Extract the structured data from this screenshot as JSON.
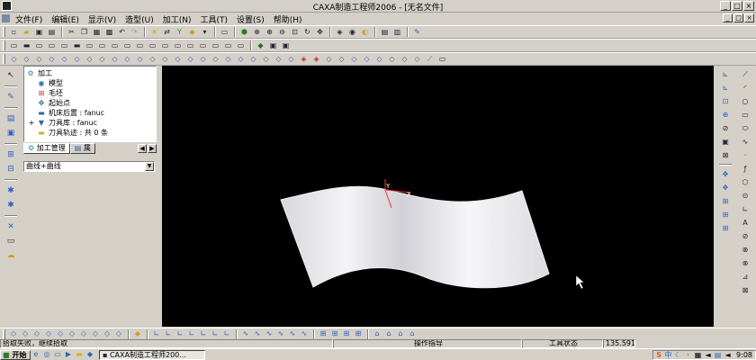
{
  "window": {
    "title": "CAXA制造工程师2006 - [无名文件]",
    "controls": [
      "_",
      "□",
      "×"
    ]
  },
  "menubar": {
    "items": [
      "文件(F)",
      "编辑(E)",
      "显示(V)",
      "造型(U)",
      "加工(N)",
      "工具(T)",
      "设置(S)",
      "帮助(H)"
    ],
    "mdi_controls": [
      "_",
      "□",
      "×"
    ]
  },
  "tree": {
    "root": "加工",
    "nodes": [
      {
        "label": "模型",
        "icon": "model-icon"
      },
      {
        "label": "毛坯",
        "icon": "blank-icon"
      },
      {
        "label": "起始点",
        "icon": "start-point-icon"
      },
      {
        "label": "机床后置 : fanuc",
        "icon": "machine-icon"
      },
      {
        "label": "刀具库 : fanuc",
        "icon": "tool-icon"
      },
      {
        "label": "刀具轨迹 : 共 0 条",
        "icon": "folder-icon"
      }
    ],
    "expand_sign": "+"
  },
  "panel": {
    "tabs": [
      "加工管理",
      "属"
    ],
    "combo_value": "曲线+曲线"
  },
  "viewport": {
    "axis_x": "X",
    "axis_y": "Y",
    "background": "#000000",
    "surface_color": "#e6e6ea"
  },
  "status": {
    "prompt": "拾取失败，继续拾取",
    "ops_label": "操作指导",
    "tool_state": "工具状态",
    "coords": "135.591"
  },
  "taskbar": {
    "start": "开始",
    "task": "CAXA制造工程师200...",
    "tray_brand": "S",
    "tray_text": "中",
    "clock": "9:08"
  }
}
